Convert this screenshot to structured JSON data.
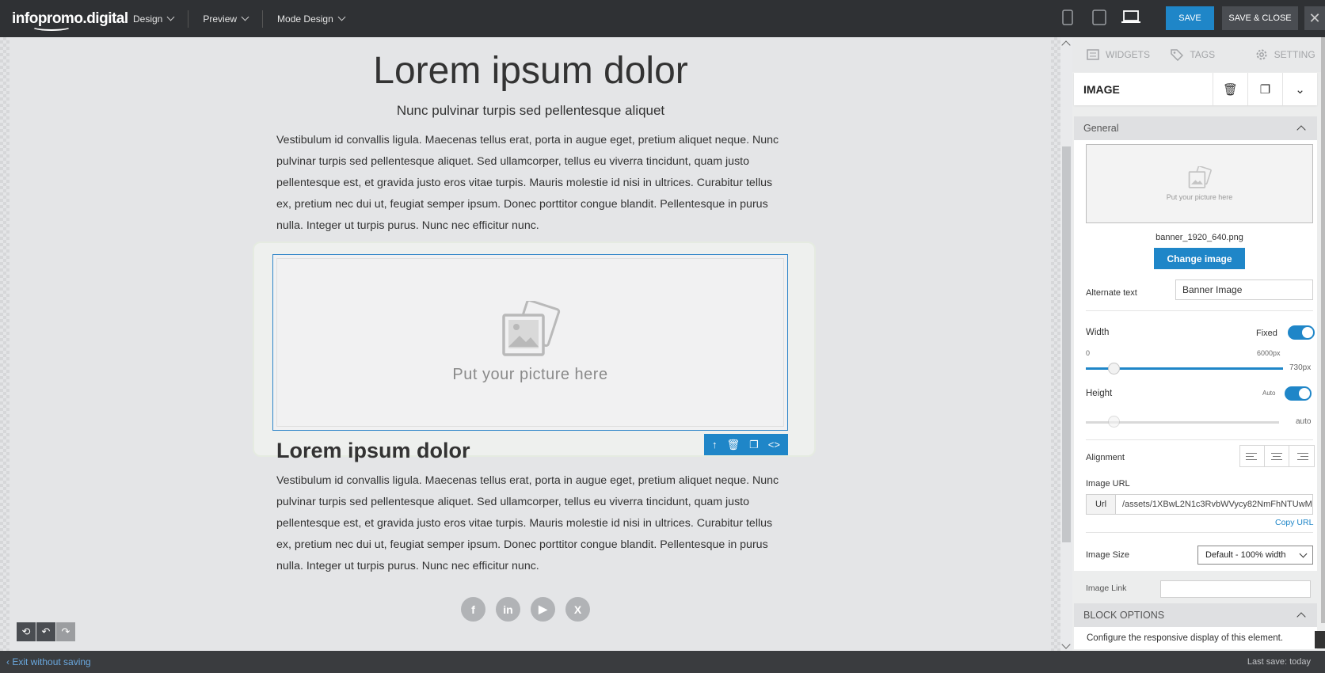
{
  "topbar": {
    "logo": "infopromo.digital",
    "menus": [
      "Design",
      "Preview",
      "Mode Design"
    ],
    "devices": [
      "mobile-icon",
      "tablet-icon",
      "desktop-icon"
    ],
    "save_label": "SAVE",
    "save_close_label": "SAVE & CLOSE",
    "close_label": "✕"
  },
  "canvas": {
    "heading": "Lorem ipsum dolor",
    "subheading": "Nunc pulvinar turpis sed pellentesque aliquet",
    "paragraph1": "Vestibulum id convallis ligula. Maecenas tellus erat, porta in augue eget, pretium aliquet neque. Nunc pulvinar turpis sed pellentesque aliquet. Sed ullamcorper, tellus eu viverra tincidunt, quam justo pellentesque est, et gravida justo eros vitae turpis. Mauris molestie id nisi in ultrices. Curabitur tellus ex, pretium nec dui ut, feugiat semper ipsum. Donec porttitor congue blandit. Pellentesque in purus nulla. Integer ut turpis purus. Nunc nec efficitur nunc.",
    "image_placeholder": "Put your picture here",
    "heading2": "Lorem ipsum dolor",
    "paragraph2": "Vestibulum id convallis ligula. Maecenas tellus erat, porta in augue eget, pretium aliquet neque. Nunc pulvinar turpis sed pellentesque aliquet. Sed ullamcorper, tellus eu viverra tincidunt, quam justo pellentesque est, et gravida justo eros vitae turpis. Mauris molestie id nisi in ultrices. Curabitur tellus ex, pretium nec dui ut, feugiat semper ipsum. Donec porttitor congue blandit. Pellentesque in purus nulla. Integer ut turpis purus. Nunc nec efficitur nunc.",
    "socials": [
      "f",
      "in",
      "▶",
      "X"
    ]
  },
  "panel": {
    "tabs": [
      "WIDGETS",
      "TAGS",
      "SETTING"
    ],
    "title": "IMAGE",
    "general_label": "General",
    "thumb_text": "Put your picture here",
    "filename": "banner_1920_640.png",
    "change_image": "Change image",
    "alt_label": "Alternate text",
    "alt_value": "Banner Image",
    "width_label": "Width",
    "fixed_label": "Fixed",
    "width_min": "0",
    "width_max": "6000px",
    "width_value": "730px",
    "height_label": "Height",
    "auto_label": "Auto",
    "height_value": "auto",
    "alignment_label": "Alignment",
    "image_url_label": "Image URL",
    "url_prefix": "Url",
    "url_value": "/assets/1XBwL2N1c3RvbWVycy82NmFhNTUwM",
    "copy_url": "Copy URL",
    "image_size_label": "Image Size",
    "image_size_value": "Default - 100% width",
    "image_link_label": "Image Link",
    "block_options": "BLOCK OPTIONS",
    "block_desc": "Configure the responsive display of this element."
  },
  "footer": {
    "exit": "Exit without saving",
    "last_save": "Last save: today"
  },
  "colors": {
    "accent": "#1f86c8",
    "topbar": "#2f3134"
  }
}
